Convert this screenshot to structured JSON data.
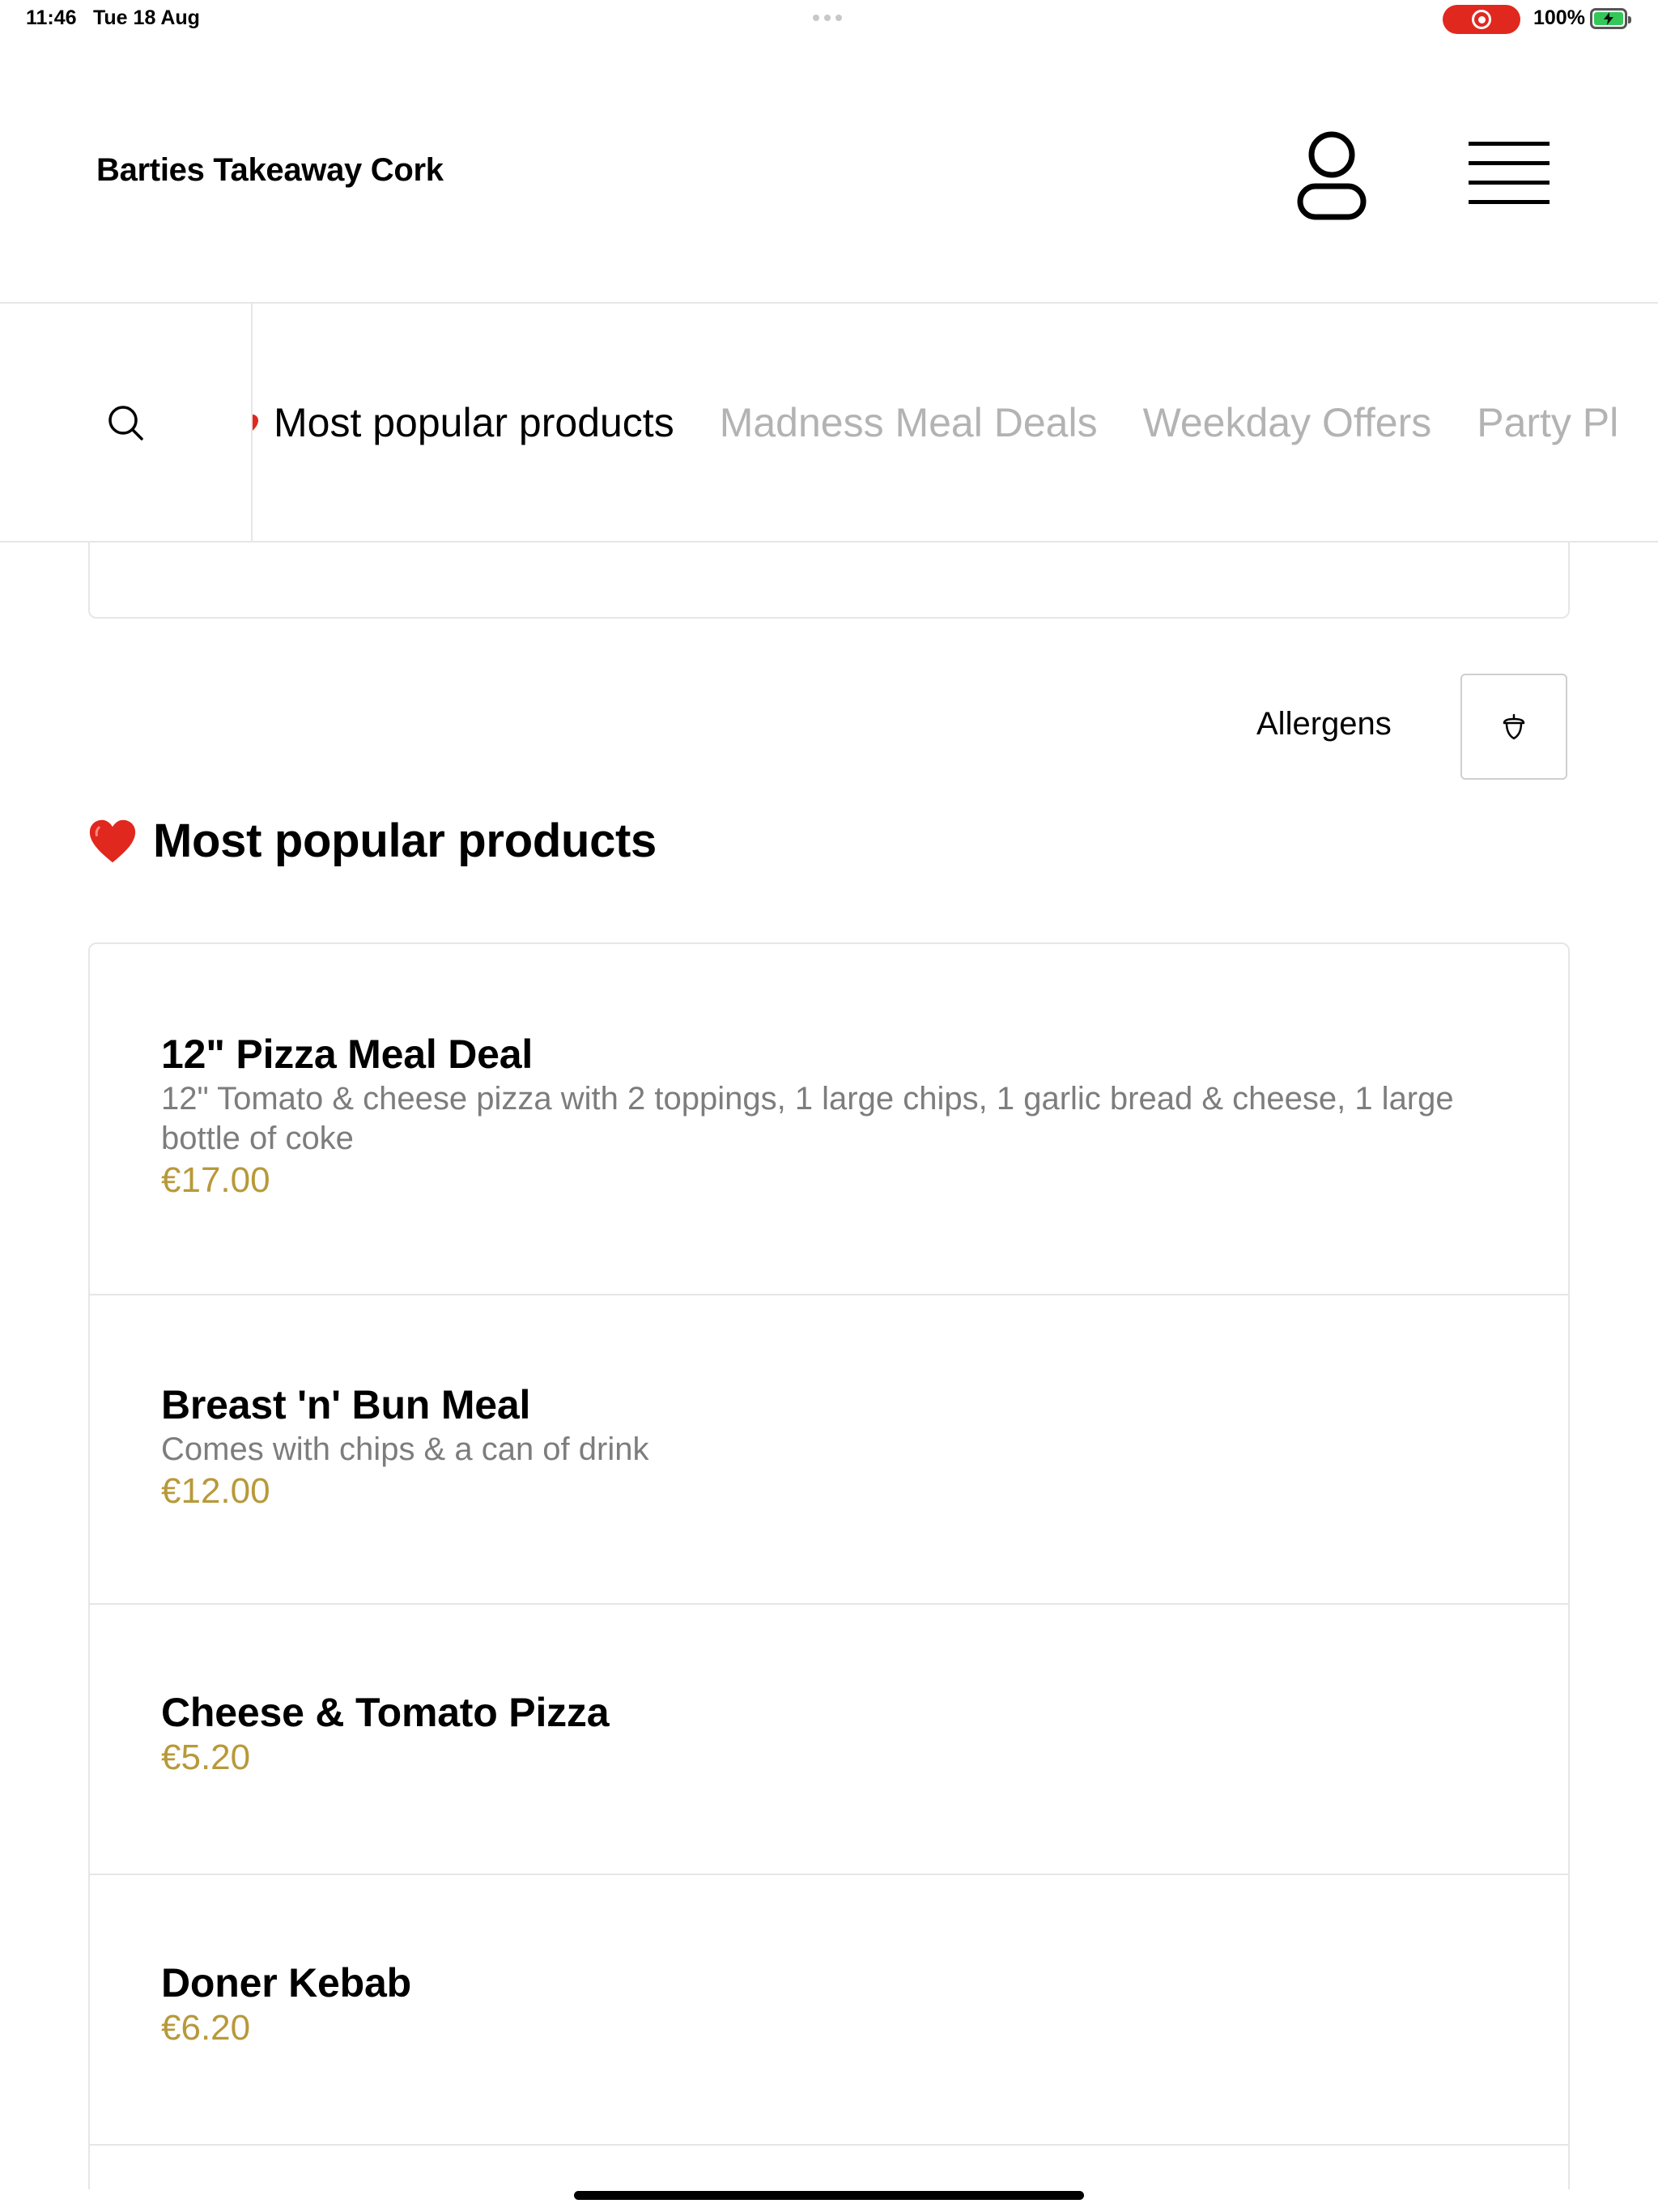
{
  "status_bar": {
    "time": "11:46",
    "date": "Tue 18 Aug",
    "battery": "100%"
  },
  "header": {
    "title": "Barties Takeaway Cork",
    "account_icon": "person-icon",
    "menu_icon": "hamburger-menu-icon"
  },
  "nav": {
    "search_icon": "search-icon",
    "tabs": [
      {
        "label": "Most popular products",
        "active": true
      },
      {
        "label": "Madness Meal Deals",
        "active": false
      },
      {
        "label": "Weekday Offers",
        "active": false
      },
      {
        "label": "Party Pl",
        "active": false
      }
    ]
  },
  "allergens": {
    "label": "Allergens",
    "icon": "acorn-icon"
  },
  "section": {
    "title": "Most popular products",
    "icon": "heart-icon"
  },
  "products": [
    {
      "name": "12\" Pizza Meal Deal",
      "description": "12\" Tomato & cheese pizza with 2 toppings, 1 large chips, 1 garlic bread & cheese, 1 large bottle of coke",
      "price": "€17.00"
    },
    {
      "name": "Breast 'n' Bun Meal",
      "description": "Comes with chips & a can of drink",
      "price": "€12.00"
    },
    {
      "name": "Cheese & Tomato Pizza",
      "description": "",
      "price": "€5.20"
    },
    {
      "name": "Doner Kebab",
      "description": "",
      "price": "€6.20"
    }
  ],
  "colors": {
    "price": "#b8993a",
    "inactive_tab": "#b3b3b3",
    "heart": "#e0281f",
    "recording": "#e0281f",
    "battery": "#34c759"
  }
}
